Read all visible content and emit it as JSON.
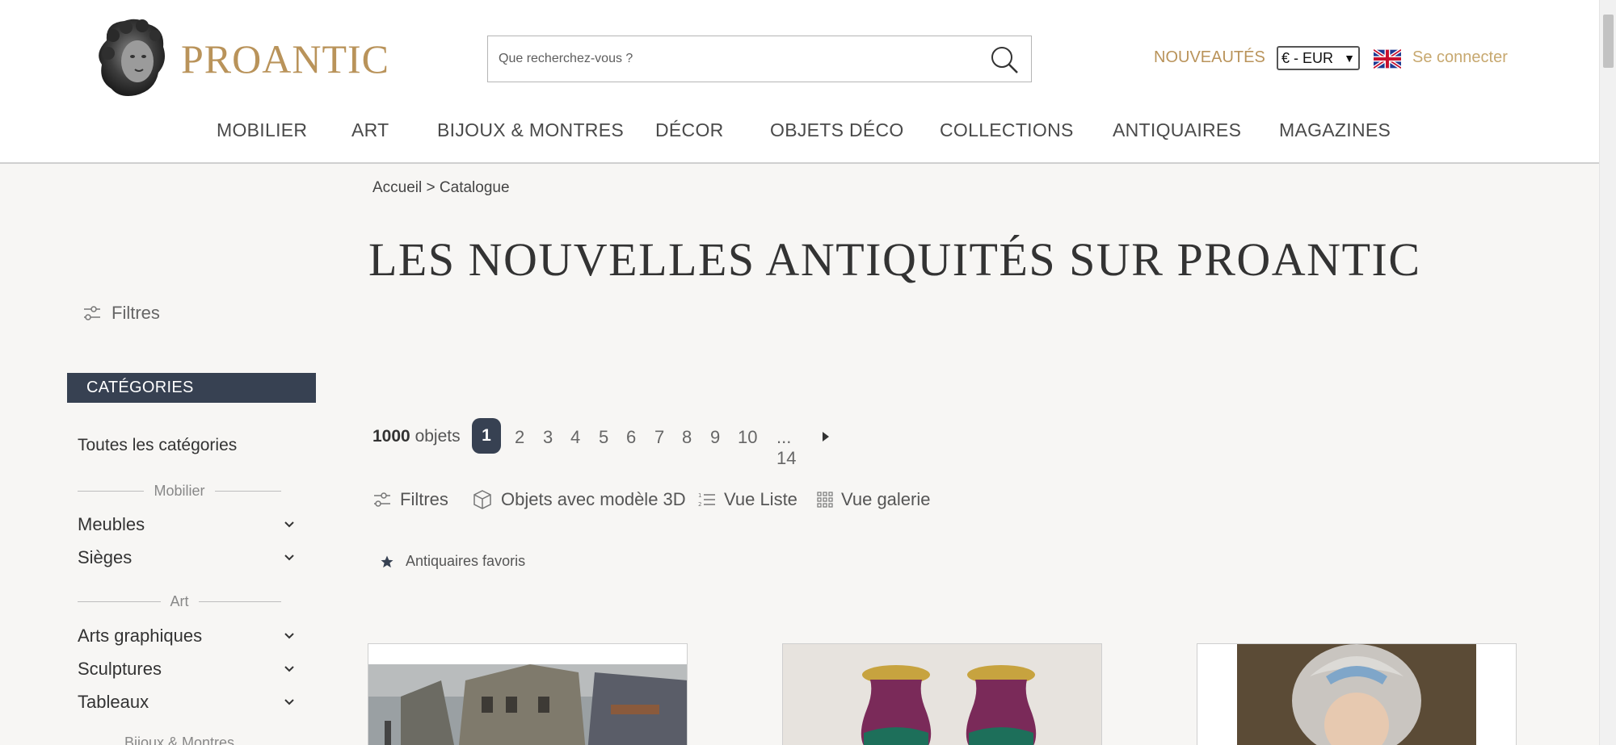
{
  "header": {
    "brand": "PROANTIC",
    "search_placeholder": "Que recherchez-vous ?",
    "nouveautes": "NOUVEAUTÉS",
    "currency": "€ - EUR",
    "login": "Se connecter"
  },
  "nav": [
    "MOBILIER",
    "ART",
    "BIJOUX & MONTRES",
    "DÉCOR",
    "OBJETS DÉCO",
    "COLLECTIONS",
    "ANTIQUAIRES",
    "MAGAZINES"
  ],
  "breadcrumb": {
    "home": "Accueil",
    "separator": ">",
    "current": "Catalogue"
  },
  "title": "LES NOUVELLES ANTIQUITÉS SUR PROANTIC",
  "sidebar": {
    "filters": "Filtres",
    "categories_header": "CATÉGORIES",
    "all_categories": "Toutes les catégories",
    "groups": [
      {
        "label": "Mobilier",
        "items": [
          "Meubles",
          "Sièges"
        ]
      },
      {
        "label": "Art",
        "items": [
          "Arts graphiques",
          "Sculptures",
          "Tableaux"
        ]
      },
      {
        "label": "Bijoux & Montres",
        "items": []
      }
    ]
  },
  "results": {
    "count": "1000",
    "count_label": "objets",
    "pages": [
      "1",
      "2",
      "3",
      "4",
      "5",
      "6",
      "7",
      "8",
      "9",
      "10"
    ],
    "ellipsis_last": "... 14",
    "current_page": "1"
  },
  "toolbar": {
    "filters": "Filtres",
    "models_3d": "Objets avec modèle 3D",
    "list_view": "Vue Liste",
    "gallery_view": "Vue galerie"
  },
  "favorites": "Antiquaires favoris",
  "colors": {
    "gold": "#b9935a",
    "navy": "#374152",
    "background": "#f7f6f4"
  }
}
